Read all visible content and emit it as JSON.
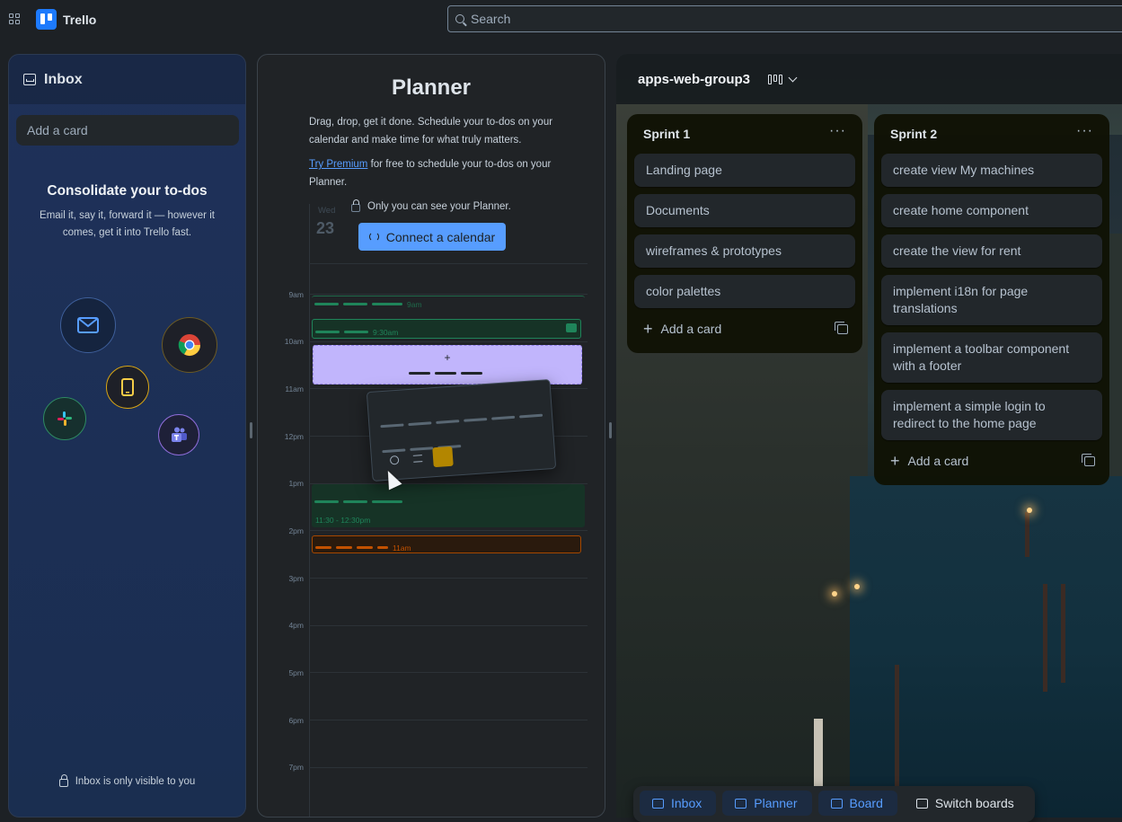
{
  "topbar": {
    "app_name": "Trello",
    "search_placeholder": "Search"
  },
  "inbox": {
    "title": "Inbox",
    "add_card_placeholder": "Add a card",
    "heading": "Consolidate your to-dos",
    "subtitle": "Email it, say it, forward it — however it comes, get it into Trello fast.",
    "footer": "Inbox is only visible to you",
    "integration_icons": [
      "mail-icon",
      "chrome-icon",
      "mobile-icon",
      "slack-icon",
      "teams-icon"
    ]
  },
  "planner": {
    "title": "Planner",
    "description": "Drag, drop, get it done. Schedule your to-dos on your calendar and make time for what truly matters.",
    "premium_link": "Try Premium",
    "premium_rest": " for free to schedule your to-dos on your Planner.",
    "private_note": "Only you can see your Planner.",
    "connect_button": "Connect a calendar",
    "day_label": "Wed",
    "date_label": "23",
    "hours": [
      "9am",
      "10am",
      "11am",
      "12pm",
      "1pm",
      "2pm",
      "3pm",
      "4pm",
      "5pm",
      "6pm",
      "7pm"
    ],
    "events": {
      "e1": "9am",
      "e2": "9:30am",
      "e3": "11:30 - 12:30pm",
      "e4": "11am"
    }
  },
  "board": {
    "name": "apps-web-group3",
    "lists": [
      {
        "title": "Sprint 1",
        "cards": [
          "Landing page",
          "Documents",
          "wireframes & prototypes",
          "color palettes"
        ],
        "add_label": "Add a card"
      },
      {
        "title": "Sprint 2",
        "cards": [
          "create view My machines",
          "create home component",
          "create the view for rent",
          "implement i18n for page translations",
          "implement a toolbar component with a footer",
          "implement a simple login to redirect to the home page"
        ],
        "add_label": "Add a card"
      }
    ]
  },
  "bottom_nav": {
    "inbox": "Inbox",
    "planner": "Planner",
    "board": "Board",
    "switch": "Switch boards"
  },
  "colors": {
    "accent": "#579dff",
    "brand": "#1d7afc",
    "drop_slot": "#c1b5fc",
    "event_green": "#1f845a",
    "event_orange": "#c25100"
  }
}
